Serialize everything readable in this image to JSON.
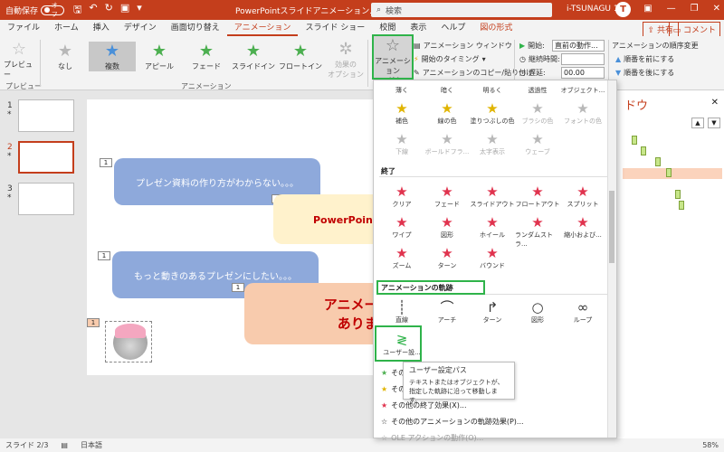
{
  "titlebar": {
    "autosave_label": "自動保存",
    "autosave_state": "オフ",
    "doc_title": "PowerPointスライドアニメーション.p...",
    "search_placeholder": "検索",
    "user_name": "i-TSUNAGU 1",
    "avatar_letter": "T"
  },
  "tabs": [
    "ファイル",
    "ホーム",
    "挿入",
    "デザイン",
    "画面切り替え",
    "アニメーション",
    "スライド ショー",
    "校閲",
    "表示",
    "ヘルプ",
    "図の形式"
  ],
  "active_tab": "アニメーション",
  "share_label": "共有",
  "comment_label": "コメント",
  "ribbon": {
    "preview_label": "プレビュー",
    "preview_group": "プレビュー",
    "gallery": [
      "なし",
      "複数",
      "アピール",
      "フェード",
      "スライドイン",
      "フロートイン"
    ],
    "effect_options": "効果の\nオプション",
    "animation_group": "アニメーション",
    "add_animation": "アニメーション\nの追加",
    "anim_pane_btn": "アニメーション ウィンドウ",
    "trigger_btn": "開始のタイミング",
    "painter_btn": "アニメーションのコピー/貼り付け",
    "start_label": "開始:",
    "start_value": "直前の動作...",
    "duration_label": "継続時間:",
    "delay_label": "遅延:",
    "delay_value": "00.00",
    "reorder_label": "アニメーションの順序変更",
    "move_earlier": "順番を前にする",
    "move_later": "順番を後にする"
  },
  "slides": [
    "1",
    "2",
    "3"
  ],
  "slide": {
    "bubble1": "プレゼン資料の作り方がわからない。。。",
    "bubble2": "PowerPoint を",
    "bubble3": "もっと動きのあるプレゼンにしたい。。。",
    "bubble4_line1": "アニメーション",
    "bubble4_line2": "ありません",
    "tag1": "1",
    "tag2": "1",
    "tag3": "1",
    "tag4": "1",
    "tag5": "1"
  },
  "pane": {
    "title": "ドウ"
  },
  "dropdown": {
    "row1": [
      "薄く",
      "暗く",
      "明るく",
      "透過性",
      "オブジェクト..."
    ],
    "row2": [
      "補色",
      "線の色",
      "塗りつぶしの色",
      "ブラシの色",
      "フォントの色"
    ],
    "row3": [
      "下線",
      "ボールドフラ...",
      "太字表示",
      "ウェーブ"
    ],
    "exit_title": "終了",
    "exit1": [
      "クリア",
      "フェード",
      "スライドアウト",
      "フロートアウト",
      "スプリット"
    ],
    "exit2": [
      "ワイプ",
      "図形",
      "ホイール",
      "ランダムストラ...",
      "縮小および..."
    ],
    "exit3": [
      "ズーム",
      "ターン",
      "バウンド"
    ],
    "path_title": "アニメーションの軌跡",
    "paths": [
      "直線",
      "アーチ",
      "ターン",
      "図形",
      "ループ"
    ],
    "custom_path": "ユーザー設...",
    "cmd1": "その",
    "cmd2": "その",
    "cmd3": "その他の終了効果(X)...",
    "cmd4": "その他のアニメーションの軌跡効果(P)...",
    "cmd5": "OLE アクションの動作(O)..."
  },
  "tooltip": {
    "title": "ユーザー設定パス",
    "body": "テキストまたはオブジェクトが、指定した軌跡に沿って移動します。"
  },
  "status": {
    "slide_info": "スライド 2/3",
    "language": "日本語",
    "zoom": "58%"
  }
}
